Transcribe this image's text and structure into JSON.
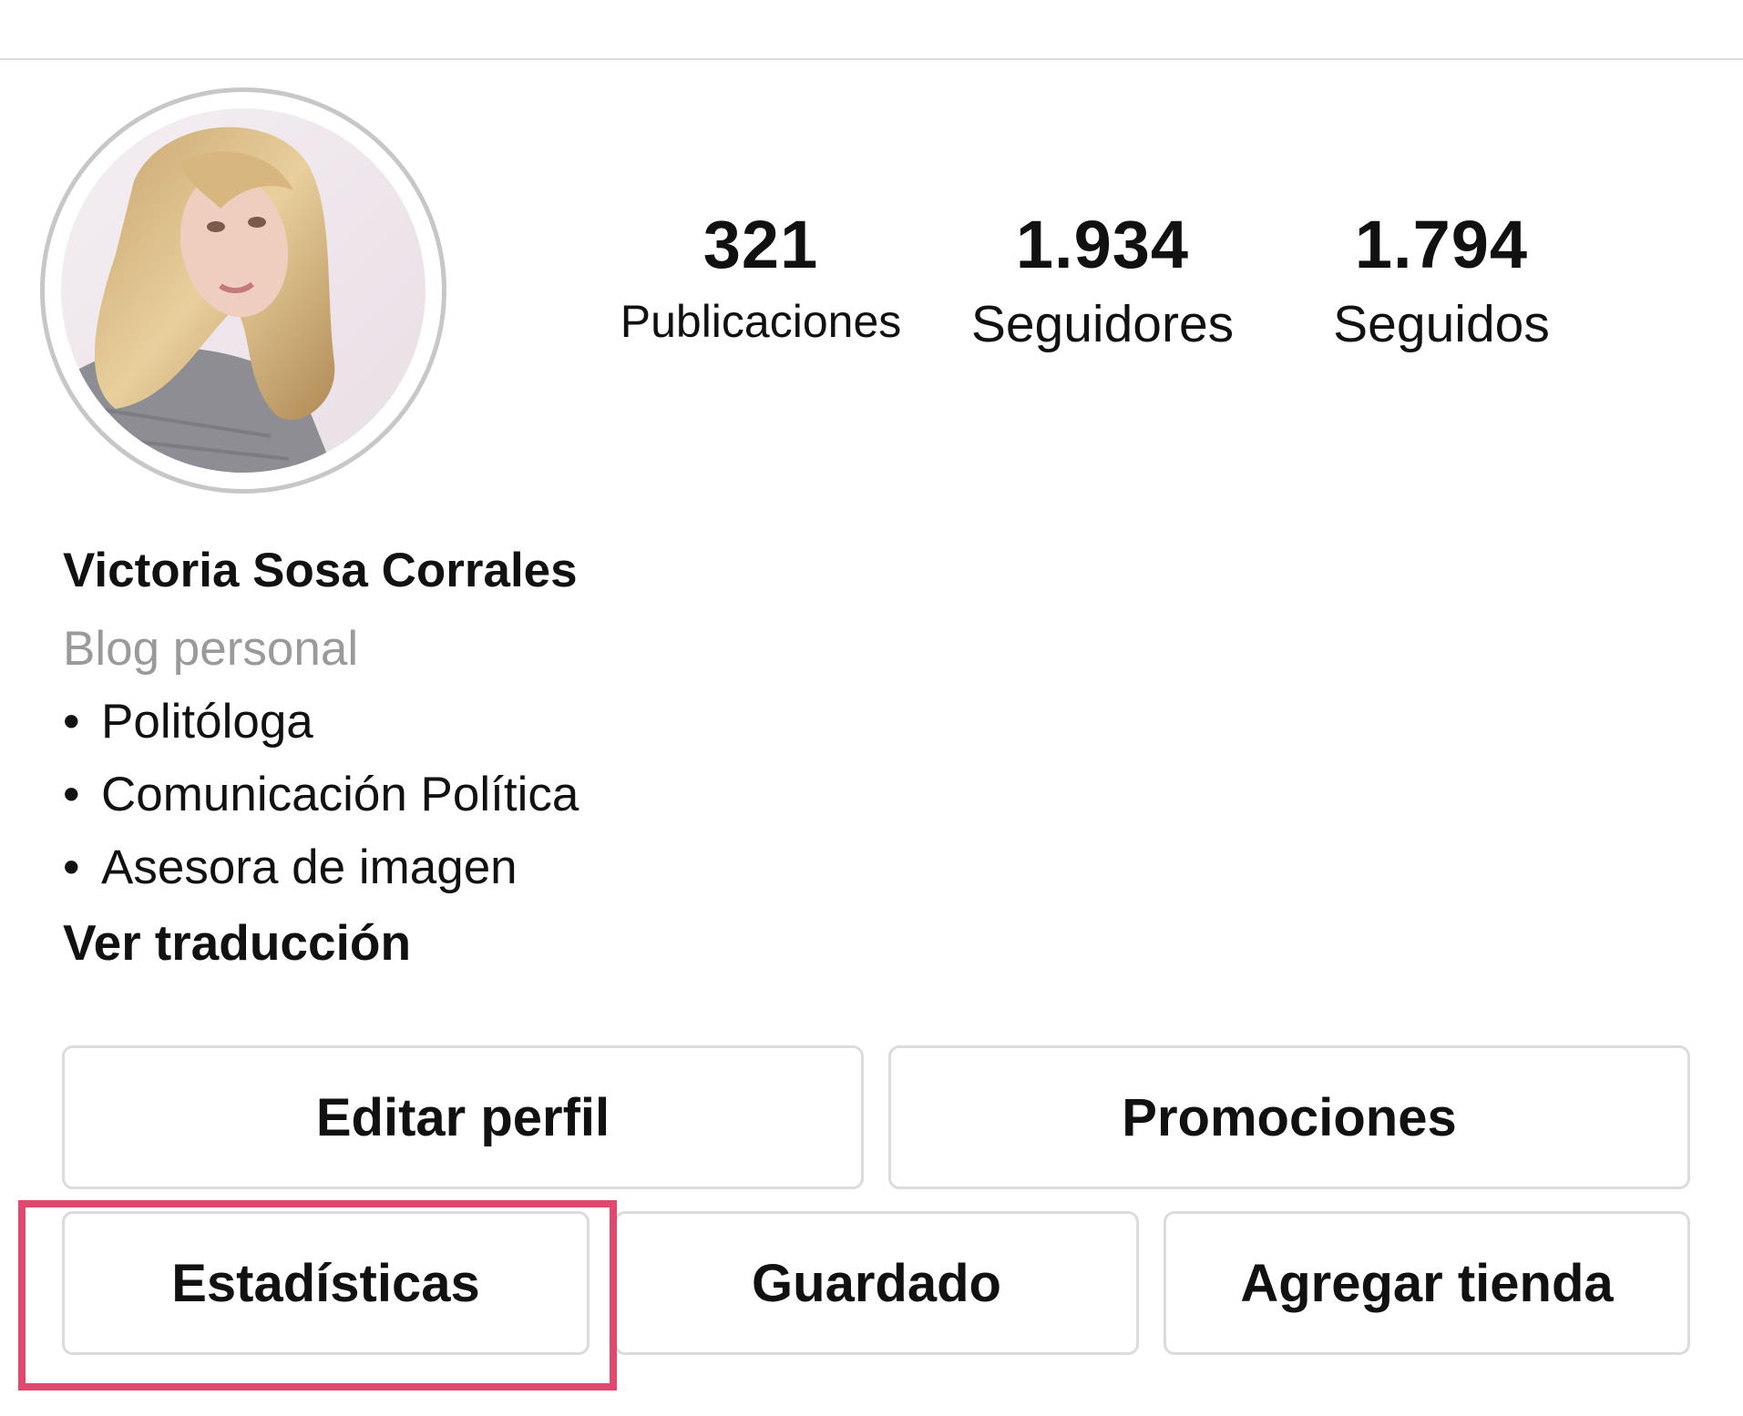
{
  "profile": {
    "avatar_icon": "profile-photo",
    "name": "Victoria Sosa Corrales",
    "category": "Blog personal",
    "bio": [
      "Politóloga",
      "Comunicación Política",
      "Asesora de imagen"
    ],
    "bullet": "•",
    "see_translation": "Ver traducción"
  },
  "stats": {
    "posts": {
      "value": "321",
      "label": "Publicaciones"
    },
    "followers": {
      "value": "1.934",
      "label": "Seguidores"
    },
    "following": {
      "value": "1.794",
      "label": "Seguidos"
    }
  },
  "actions": {
    "edit_profile": "Editar perfil",
    "promotions": "Promociones",
    "insights": "Estadísticas",
    "saved": "Guardado",
    "add_shop": "Agregar tienda"
  },
  "annotation": {
    "highlight_color": "#e0486d"
  }
}
